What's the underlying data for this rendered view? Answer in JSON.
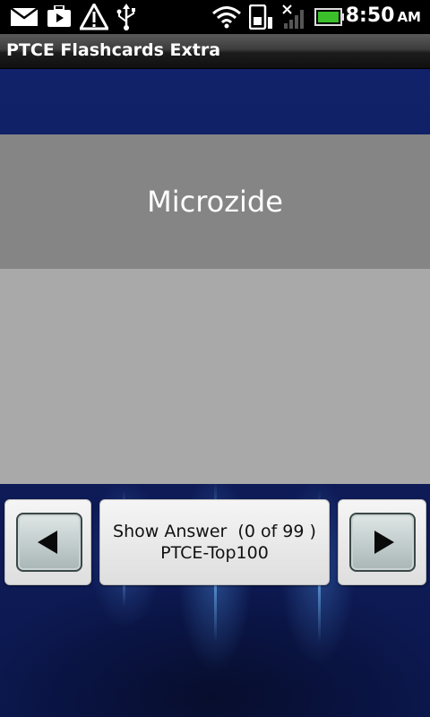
{
  "status_bar": {
    "time": "8:50",
    "ampm": "AM",
    "icons": [
      "mail-icon",
      "briefcase-icon",
      "warning-icon",
      "usb-icon",
      "wifi-icon",
      "sd-card-icon",
      "no-signal-icon",
      "battery-icon"
    ]
  },
  "app": {
    "title": "PTCE Flashcards Extra"
  },
  "card": {
    "term": "Microzide"
  },
  "controls": {
    "prev_icon": "left-arrow-icon",
    "next_icon": "right-arrow-icon",
    "show_answer_label": "Show Answer  (0 of 99 )",
    "deck_name": "PTCE-Top100"
  },
  "colors": {
    "background": "#0f1e55",
    "card_front": "#858585",
    "card_back": "#a9a9a9",
    "battery": "#3bbf2b"
  }
}
